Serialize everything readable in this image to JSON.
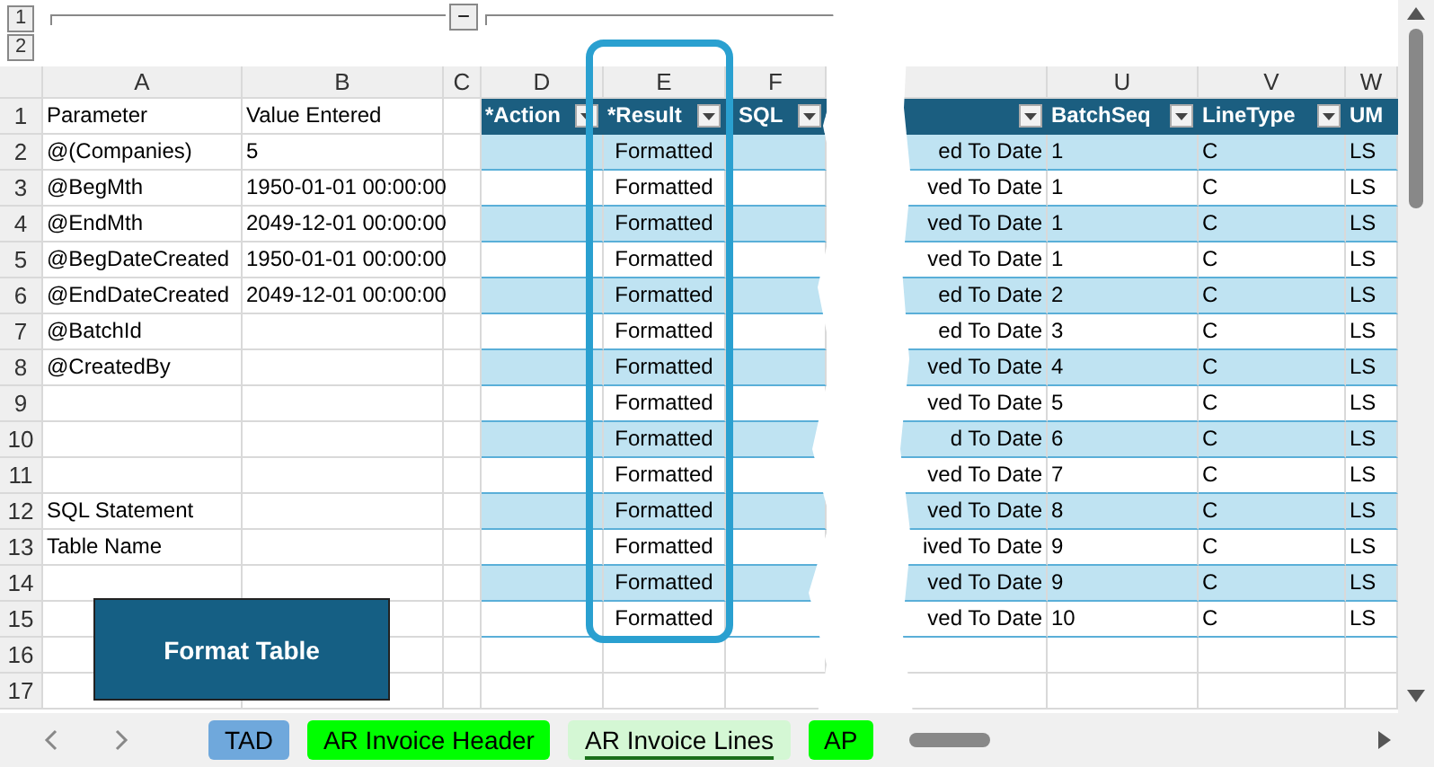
{
  "outline": {
    "levels": [
      "1",
      "2"
    ],
    "toggle": "−"
  },
  "left_pane": {
    "columns": [
      "A",
      "B",
      "C",
      "D",
      "E",
      "F"
    ],
    "table_headers": [
      "*Action",
      "*Result",
      "SQL"
    ],
    "rows": [
      {
        "number": "1",
        "parameter": "Parameter",
        "value": "Value Entered"
      },
      {
        "number": "2",
        "parameter": "@(Companies)",
        "value": "5",
        "result": "Formatted"
      },
      {
        "number": "3",
        "parameter": "@BegMth",
        "value": "1950-01-01 00:00:00",
        "result": "Formatted"
      },
      {
        "number": "4",
        "parameter": "@EndMth",
        "value": "2049-12-01 00:00:00",
        "result": "Formatted"
      },
      {
        "number": "5",
        "parameter": "@BegDateCreated",
        "value": "1950-01-01 00:00:00",
        "result": "Formatted"
      },
      {
        "number": "6",
        "parameter": "@EndDateCreated",
        "value": "2049-12-01 00:00:00",
        "result": "Formatted"
      },
      {
        "number": "7",
        "parameter": "@BatchId",
        "result": "Formatted"
      },
      {
        "number": "8",
        "parameter": "@CreatedBy",
        "result": "Formatted"
      },
      {
        "number": "9",
        "result": "Formatted"
      },
      {
        "number": "10",
        "result": "Formatted"
      },
      {
        "number": "11",
        "result": "Formatted"
      },
      {
        "number": "12",
        "parameter": "SQL Statement",
        "result": "Formatted"
      },
      {
        "number": "13",
        "parameter": "Table Name",
        "result": "Formatted"
      },
      {
        "number": "14",
        "result": "Formatted"
      },
      {
        "number": "15",
        "result": "Formatted"
      },
      {
        "number": "16"
      },
      {
        "number": "17"
      }
    ]
  },
  "format_button": "Format Table",
  "right_pane": {
    "columns": [
      "U",
      "V",
      "W"
    ],
    "table_headers": [
      "BatchSeq",
      "LineType",
      "UM"
    ],
    "rows": [
      {
        "text": "ed To Date",
        "batch_seq": "1",
        "line_type": "C",
        "um": "LS"
      },
      {
        "text": "ved To Date",
        "batch_seq": "1",
        "line_type": "C",
        "um": "LS"
      },
      {
        "text": "ved To Date",
        "batch_seq": "1",
        "line_type": "C",
        "um": "LS"
      },
      {
        "text": "ved To Date",
        "batch_seq": "1",
        "line_type": "C",
        "um": "LS"
      },
      {
        "text": "ed To Date",
        "batch_seq": "2",
        "line_type": "C",
        "um": "LS"
      },
      {
        "text": "ed To Date",
        "batch_seq": "3",
        "line_type": "C",
        "um": "LS"
      },
      {
        "text": "ved To Date",
        "batch_seq": "4",
        "line_type": "C",
        "um": "LS"
      },
      {
        "text": "ved To Date",
        "batch_seq": "5",
        "line_type": "C",
        "um": "LS"
      },
      {
        "text": "d To Date",
        "batch_seq": "6",
        "line_type": "C",
        "um": "LS"
      },
      {
        "text": "ved To Date",
        "batch_seq": "7",
        "line_type": "C",
        "um": "LS"
      },
      {
        "text": "ved To Date",
        "batch_seq": "8",
        "line_type": "C",
        "um": "LS"
      },
      {
        "text": "ived To Date",
        "batch_seq": "9",
        "line_type": "C",
        "um": "LS"
      },
      {
        "text": "ved To Date",
        "batch_seq": "9",
        "line_type": "C",
        "um": "LS"
      },
      {
        "text": "ved To Date",
        "batch_seq": "10",
        "line_type": "C",
        "um": "LS"
      }
    ]
  },
  "sheet_tabs": [
    {
      "label": "TAD",
      "color": "#6fa8dc",
      "selected": false
    },
    {
      "label": "AR Invoice Header",
      "color": "#00ff00",
      "selected": false
    },
    {
      "label": "AR Invoice Lines",
      "color": "#d4f7d4",
      "selected": true
    },
    {
      "label": "AP",
      "color": "#00ff00",
      "selected": false
    }
  ]
}
